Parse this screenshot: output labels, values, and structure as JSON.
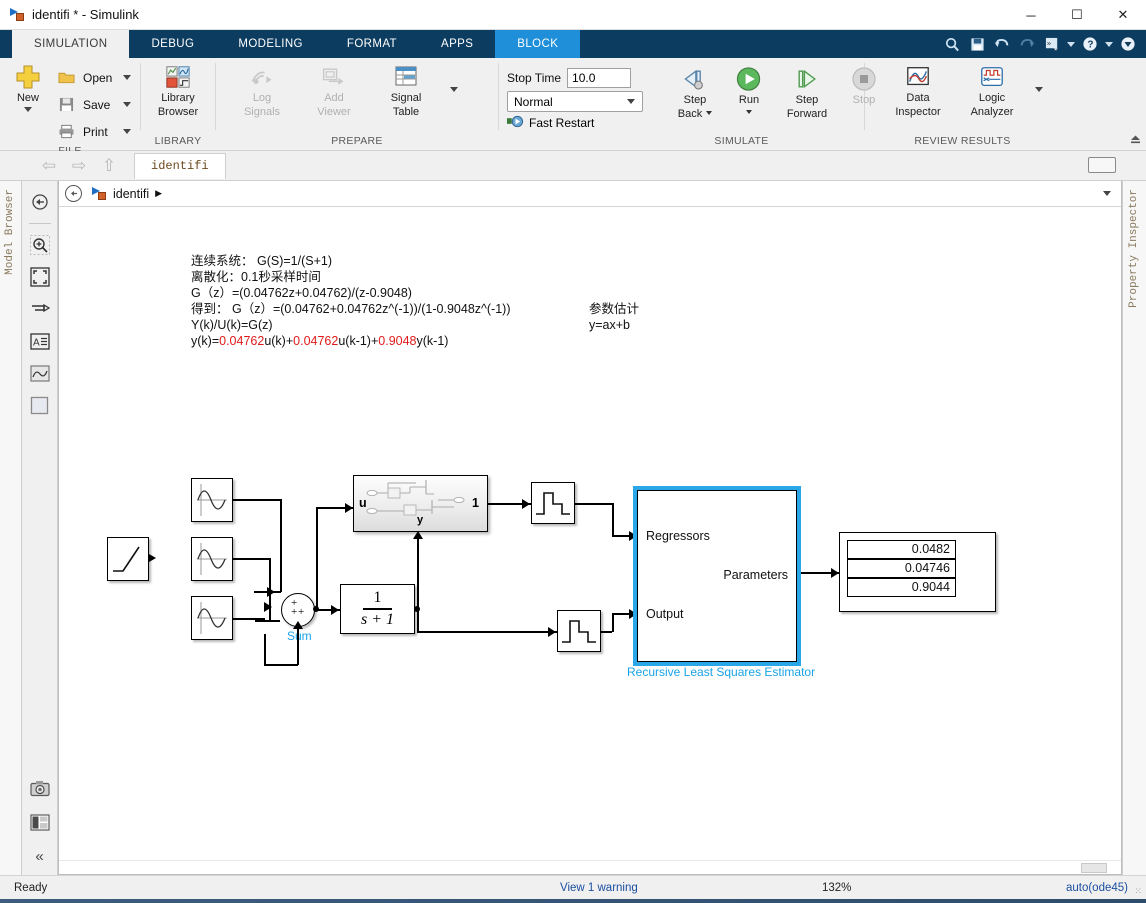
{
  "window": {
    "title": "identifi * - Simulink",
    "logo_icon": "simulink-logo-icon",
    "minimize": "─",
    "maximize": "☐",
    "close": "✕"
  },
  "tabs": [
    {
      "label": "SIMULATION",
      "state": "active"
    },
    {
      "label": "DEBUG",
      "state": "normal"
    },
    {
      "label": "MODELING",
      "state": "normal"
    },
    {
      "label": "FORMAT",
      "state": "normal"
    },
    {
      "label": "APPS",
      "state": "normal"
    },
    {
      "label": "BLOCK",
      "state": "contextual-active"
    }
  ],
  "quick_access": [
    {
      "name": "search-icon",
      "glyph": "⌕"
    },
    {
      "name": "save-icon",
      "glyph": "ὋE"
    },
    {
      "name": "undo-icon",
      "glyph": "↶"
    },
    {
      "name": "redo-icon",
      "glyph": "↷"
    },
    {
      "name": "favorites-icon",
      "glyph": "»"
    },
    {
      "name": "favorites-dropdown-icon",
      "glyph": "▼"
    },
    {
      "name": "help-icon",
      "glyph": "?"
    },
    {
      "name": "help-dropdown-icon",
      "glyph": "▼"
    },
    {
      "name": "minimize-ribbon-icon",
      "glyph": "▼"
    }
  ],
  "ribbon": {
    "groups": [
      {
        "name": "file",
        "label": "FILE",
        "new_button": "New",
        "items": [
          {
            "label": "Open",
            "icon": "folder-icon"
          },
          {
            "label": "Save",
            "icon": "floppy-icon"
          },
          {
            "label": "Print",
            "icon": "printer-icon"
          }
        ]
      },
      {
        "name": "library",
        "label": "LIBRARY",
        "items": [
          {
            "label": "Library\nBrowser",
            "line1": "Library",
            "line2": "Browser",
            "icon": "library-browser-icon"
          }
        ]
      },
      {
        "name": "prepare",
        "label": "PREPARE",
        "items": [
          {
            "line1": "Log",
            "line2": "Signals",
            "icon": "log-signals-icon",
            "disabled": true
          },
          {
            "line1": "Add",
            "line2": "Viewer",
            "icon": "add-viewer-icon",
            "disabled": true
          },
          {
            "line1": "Signal",
            "line2": "Table",
            "icon": "signal-table-icon",
            "disabled": false
          }
        ]
      },
      {
        "name": "simulate",
        "label": "SIMULATE",
        "stop_time_label": "Stop Time",
        "stop_time_value": "10.0",
        "sim_mode_value": "Normal",
        "fast_restart_label": "Fast Restart",
        "items": [
          {
            "line1": "Step",
            "line2": "Back",
            "icon": "step-back-icon",
            "has_caret": true
          },
          {
            "line1": "Run",
            "line2": "",
            "icon": "run-icon",
            "has_caret": true
          },
          {
            "line1": "Step",
            "line2": "Forward",
            "icon": "step-forward-icon",
            "has_caret": false
          },
          {
            "line1": "Stop",
            "line2": "",
            "icon": "stop-icon",
            "disabled": true
          }
        ]
      },
      {
        "name": "review-results",
        "label": "REVIEW RESULTS",
        "items": [
          {
            "line1": "Data",
            "line2": "Inspector",
            "icon": "data-inspector-icon"
          },
          {
            "line1": "Logic",
            "line2": "Analyzer",
            "icon": "logic-analyzer-icon"
          }
        ]
      }
    ]
  },
  "model_tab": {
    "label": "identifi",
    "back_arrow": "⇦",
    "forward_arrow": "⇨",
    "up_arrow": "⇧"
  },
  "breadcrumb": {
    "model_name": "identifi",
    "separator": "▶",
    "icon": "simulink-model-icon"
  },
  "left_panel": {
    "vertical_tab": "Model Browser",
    "tools": [
      {
        "name": "pan-back-icon",
        "glyph": "←"
      },
      {
        "name": "zoom-in-icon",
        "glyph": "+"
      },
      {
        "name": "fit-to-view-icon",
        "glyph": "⤡"
      },
      {
        "name": "signal-lines-icon",
        "glyph": "⇥"
      },
      {
        "name": "annotation-icon",
        "glyph": "A"
      },
      {
        "name": "scope-icon",
        "glyph": "∿"
      },
      {
        "name": "area-icon",
        "glyph": "□"
      }
    ],
    "bottom_tools": [
      {
        "name": "camera-icon",
        "glyph": "▣"
      },
      {
        "name": "layout-icon",
        "glyph": "▤"
      },
      {
        "name": "collapse-icon",
        "glyph": "«"
      }
    ]
  },
  "right_panel": {
    "vertical_tab": "Property Inspector"
  },
  "status_bar": {
    "ready": "Ready",
    "warning": "View 1 warning",
    "zoom": "132%",
    "solver": "auto(ode45)"
  },
  "diagram": {
    "annotations": [
      {
        "name": "annotation-continuous-system",
        "text": "连续系统： G(S)=1/(S+1)"
      },
      {
        "name": "annotation-discretization",
        "text": "离散化：0.1秒采样时间"
      },
      {
        "name": "annotation-gz",
        "text": "G（z）=(0.04762z+0.04762)/(z-0.9048)"
      },
      {
        "name": "annotation-gz-inverse",
        "text": "得到： G（z）=(0.04762+0.04762z^(-1))/(1-0.9048z^(-1))"
      },
      {
        "name": "annotation-yu-ratio",
        "text": "Y(k)/U(k)=G(z)"
      }
    ],
    "difference_equation": {
      "prefix": "y(k)=",
      "c1": "0.04762",
      "t1": "u(k)+",
      "c2": "0.04762",
      "t2": "u(k-1)+",
      "c3": "0.9048",
      "t3": "y(k-1)"
    },
    "side_annotations": [
      {
        "name": "annotation-parameter-estimation",
        "text": "参数估计"
      },
      {
        "name": "annotation-linear-model",
        "text": "y=ax+b"
      }
    ],
    "blocks": {
      "ramp": {
        "name": "ramp-block",
        "icon": "ramp-signal-icon"
      },
      "sine1": {
        "name": "sine-wave-block-1",
        "icon": "sine-wave-icon"
      },
      "sine2": {
        "name": "sine-wave-block-2",
        "icon": "sine-wave-icon"
      },
      "sine3": {
        "name": "sine-wave-block-3",
        "icon": "sine-wave-icon"
      },
      "sum": {
        "name": "sum-block",
        "label": "Sum",
        "signs": [
          "+",
          "+",
          "+"
        ]
      },
      "transfer_fcn": {
        "name": "transfer-function-block",
        "numerator": "1",
        "denominator": "s + 1"
      },
      "subsystem": {
        "name": "subsystem-block",
        "input_port": "u",
        "second_port": "y",
        "output_port": "1"
      },
      "scope_top": {
        "name": "scope-block-top",
        "icon": "scope-icon"
      },
      "scope_bottom": {
        "name": "scope-block-bottom",
        "icon": "scope-icon"
      },
      "rls": {
        "name": "recursive-least-squares-estimator-block",
        "label": "Recursive Least Squares Estimator",
        "input_ports": [
          "Regressors",
          "Output"
        ],
        "output_ports": [
          "Parameters"
        ]
      },
      "display": {
        "name": "display-block",
        "values": [
          "0.0482",
          "0.04746",
          "0.9044"
        ]
      }
    }
  }
}
